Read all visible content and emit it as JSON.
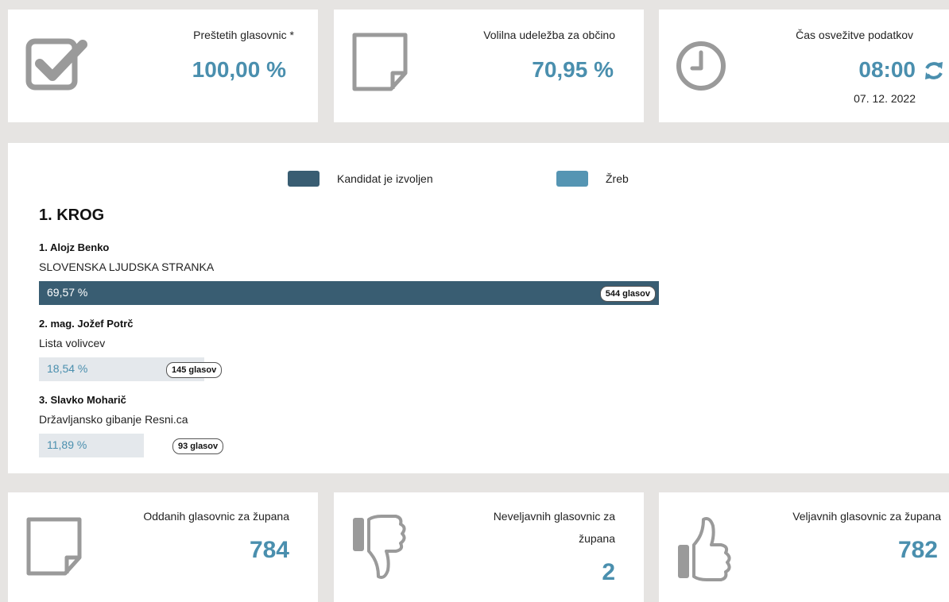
{
  "summary": {
    "counted": {
      "label": "Preštetih glasovnic *",
      "value": "100,00 %"
    },
    "turnout": {
      "label": "Volilna udeležba za občino",
      "value": "70,95 %"
    },
    "refresh": {
      "label": "Čas osvežitve podatkov",
      "time": "08:00",
      "date": "07. 12. 2022"
    }
  },
  "legend": {
    "elected": {
      "label": "Kandidat je izvoljen",
      "color": "#395d72"
    },
    "draw": {
      "label": "Žreb",
      "color": "#5595b3"
    }
  },
  "round": {
    "title": "1. KROG",
    "candidates": [
      {
        "name": "1. Alojz Benko",
        "party": "SLOVENSKA LJUDSKA STRANKA",
        "percent_label": "69,57 %",
        "percent": 69.57,
        "votes": "544 glasov",
        "elected": true
      },
      {
        "name": "2. mag. Jožef Potrč",
        "party": "Lista volivcev",
        "percent_label": "18,54 %",
        "percent": 18.54,
        "votes": "145 glasov",
        "elected": false
      },
      {
        "name": "3. Slavko Moharič",
        "party": "Državljansko gibanje Resni.ca",
        "percent_label": "11,89 %",
        "percent": 11.89,
        "votes": "93 glasov",
        "elected": false
      }
    ]
  },
  "ballots": {
    "cast": {
      "label": "Oddanih glasovnic za župana",
      "value": "784"
    },
    "invalid": {
      "label_line1": "Neveljavnih glasovnic za",
      "label_line2": "župana",
      "value": "2"
    },
    "valid": {
      "label": "Veljavnih glasovnic za župana",
      "value": "782"
    }
  },
  "colors": {
    "accent": "#4a8fae",
    "elected_bar": "#395d72",
    "other_bar": "#e4e8ec",
    "icon_gray": "#9a9a9a"
  },
  "icons": [
    "checkbox-icon",
    "document-icon",
    "clock-icon",
    "refresh-icon",
    "thumbs-down-icon",
    "thumbs-up-icon"
  ]
}
